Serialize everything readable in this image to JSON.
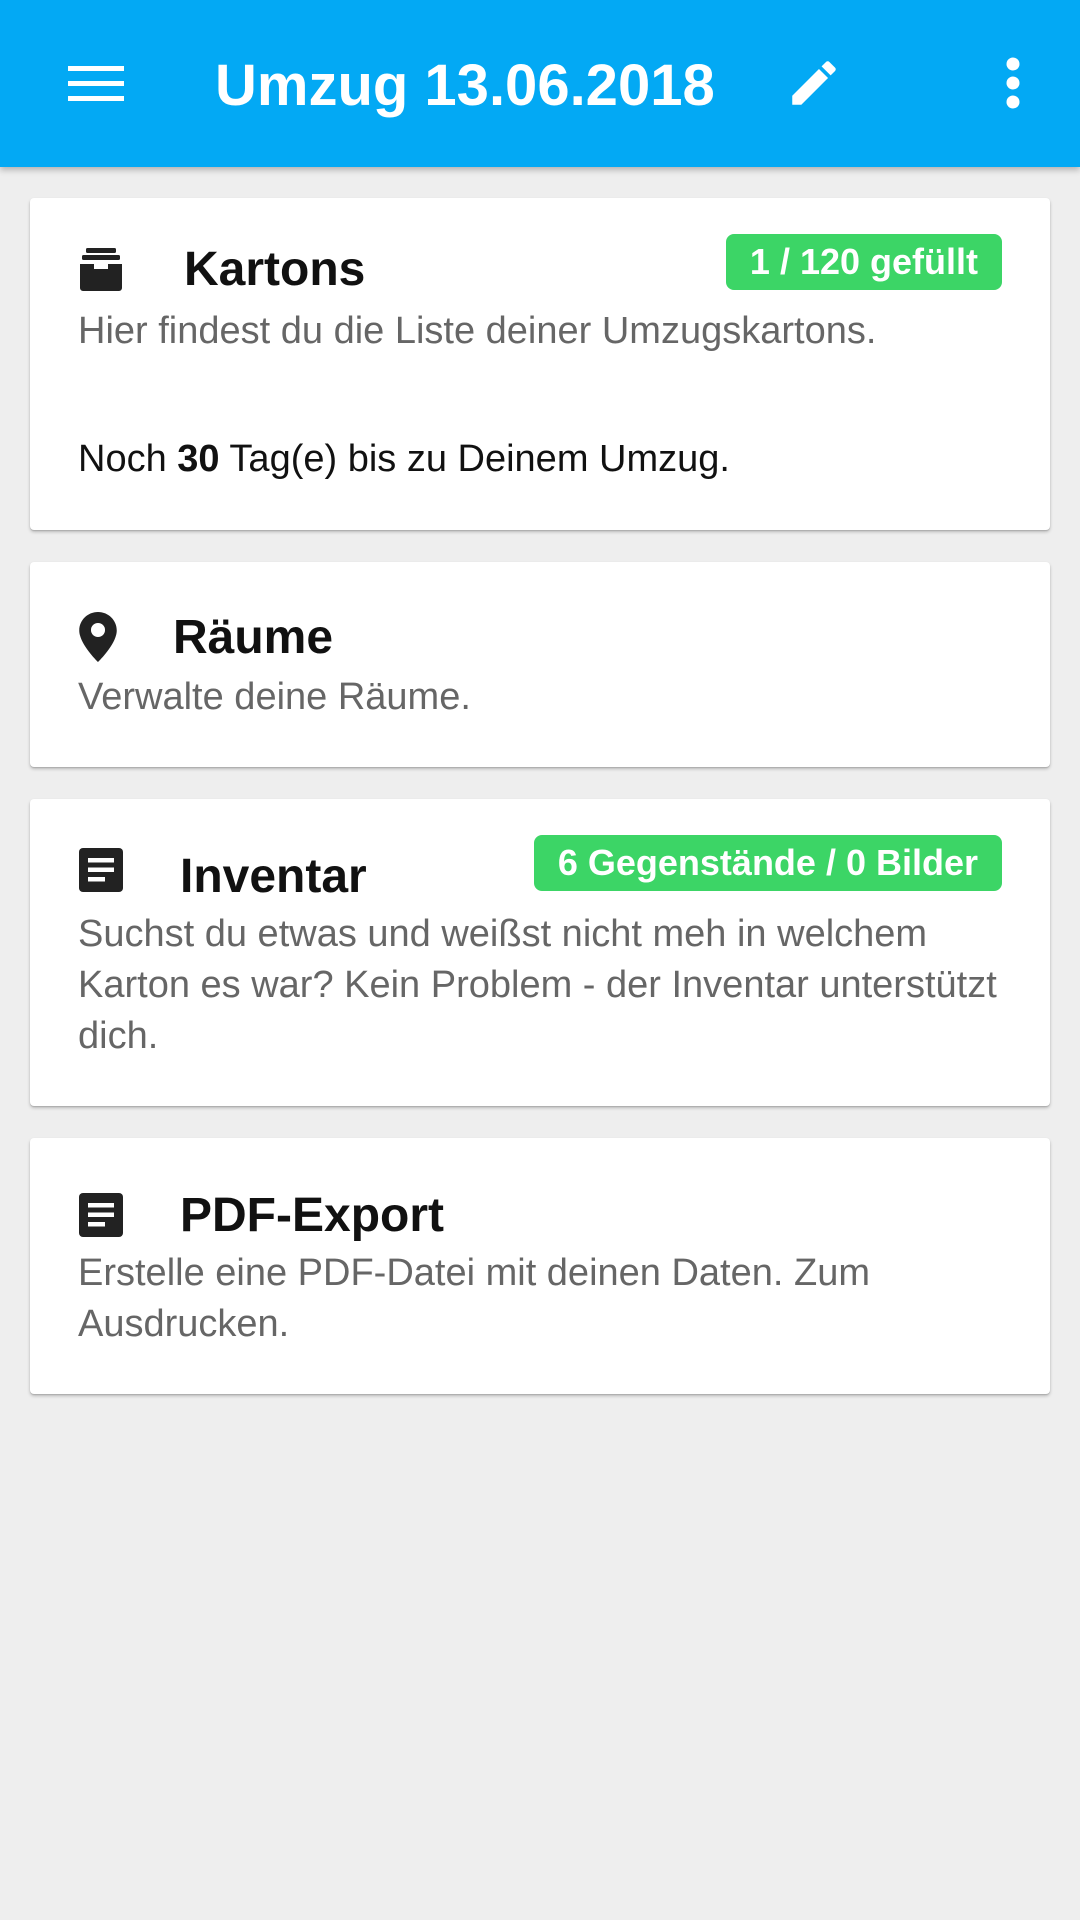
{
  "appbar": {
    "title": "Umzug 13.06.2018",
    "menu_icon": "menu-icon",
    "edit_icon": "pencil-icon",
    "more_icon": "more-vertical-icon",
    "color": "#03a9f4"
  },
  "cards": {
    "kartons": {
      "icon": "archive-box-icon",
      "title": "Kartons",
      "badge": "1 / 120 gefüllt",
      "description": "Hier findest du die Liste deiner Umzugskartons.",
      "countdown_prefix": "Noch ",
      "countdown_days": "30",
      "countdown_suffix": " Tag(e) bis zu Deinem Umzug."
    },
    "raeume": {
      "icon": "map-marker-icon",
      "title": "Räume",
      "description": "Verwalte deine Räume."
    },
    "inventar": {
      "icon": "document-list-icon",
      "title": "Inventar",
      "badge": "6 Gegenstände / 0 Bilder",
      "description": "Suchst du etwas und weißst nicht meh in welchem Karton es war? Kein Problem - der Inventar unterstützt dich."
    },
    "pdf_export": {
      "icon": "document-list-icon",
      "title": "PDF-Export",
      "description": "Erstelle eine PDF-Datei mit deinen Daten. Zum Ausdrucken."
    }
  },
  "colors": {
    "badge": "#3cd566",
    "background": "#eeeeee",
    "card": "#ffffff"
  }
}
